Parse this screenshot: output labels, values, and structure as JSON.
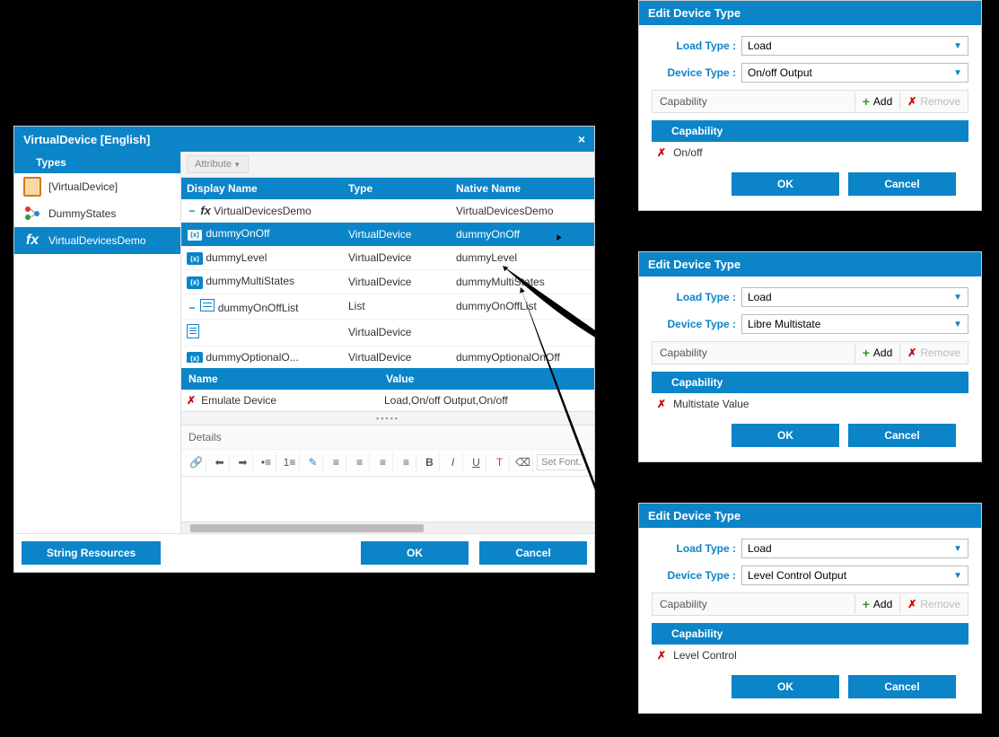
{
  "main": {
    "title": "VirtualDevice [English]",
    "types_header": "Types",
    "sidebar": [
      {
        "label": "[VirtualDevice]"
      },
      {
        "label": "DummyStates"
      },
      {
        "label": "VirtualDevicesDemo"
      }
    ],
    "attribute_btn": "Attribute",
    "grid_headers": {
      "display": "Display Name",
      "type": "Type",
      "native": "Native Name"
    },
    "rows": [
      {
        "display": "VirtualDevicesDemo",
        "type": "",
        "native": "VirtualDevicesDemo"
      },
      {
        "display": "dummyOnOff",
        "type": "VirtualDevice",
        "native": "dummyOnOff"
      },
      {
        "display": "dummyLevel",
        "type": "VirtualDevice",
        "native": "dummyLevel"
      },
      {
        "display": "dummyMultiStates",
        "type": "VirtualDevice",
        "native": "dummyMultiStates"
      },
      {
        "display": "dummyOnOffList",
        "type": "List",
        "native": "dummyOnOffList"
      },
      {
        "display": "",
        "type": "VirtualDevice",
        "native": ""
      },
      {
        "display": "dummyOptionalO...",
        "type": "VirtualDevice",
        "native": "dummyOptionalOnOff"
      }
    ],
    "nv_headers": {
      "name": "Name",
      "value": "Value"
    },
    "nv_row": {
      "name": "Emulate Device",
      "value": "Load,On/off Output,On/off"
    },
    "details_label": "Details",
    "font_placeholder": "Set Font.",
    "string_resources": "String Resources",
    "ok": "OK",
    "cancel": "Cancel"
  },
  "edits": [
    {
      "title": "Edit Device Type",
      "load_label": "Load Type :",
      "load_val": "Load",
      "dev_label": "Device Type :",
      "dev_val": "On/off Output",
      "cap_label": "Capability",
      "add": "Add",
      "remove": "Remove",
      "cap_header": "Capability",
      "cap_item": "On/off",
      "ok": "OK",
      "cancel": "Cancel"
    },
    {
      "title": "Edit Device Type",
      "load_label": "Load Type :",
      "load_val": "Load",
      "dev_label": "Device Type :",
      "dev_val": "Libre Multistate",
      "cap_label": "Capability",
      "add": "Add",
      "remove": "Remove",
      "cap_header": "Capability",
      "cap_item": "Multistate Value",
      "ok": "OK",
      "cancel": "Cancel"
    },
    {
      "title": "Edit Device Type",
      "load_label": "Load Type :",
      "load_val": "Load",
      "dev_label": "Device Type :",
      "dev_val": "Level Control Output",
      "cap_label": "Capability",
      "add": "Add",
      "remove": "Remove",
      "cap_header": "Capability",
      "cap_item": "Level Control",
      "ok": "OK",
      "cancel": "Cancel"
    }
  ]
}
